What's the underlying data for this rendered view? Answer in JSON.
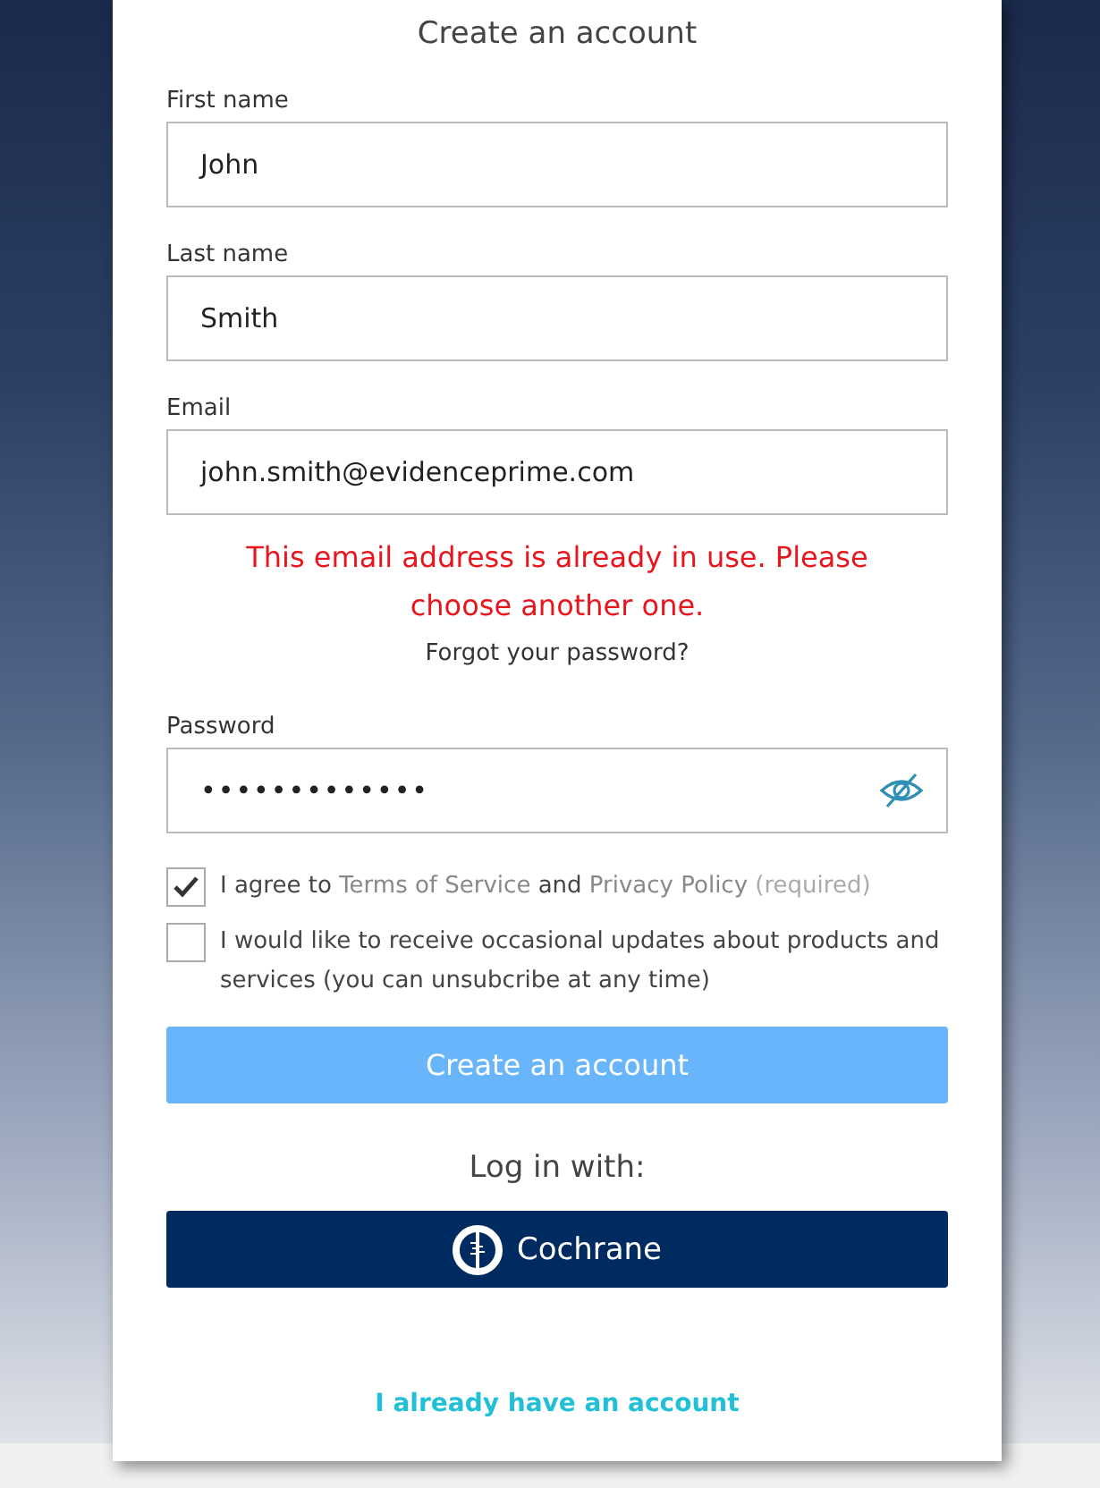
{
  "title": "Create an account",
  "fields": [
    {
      "label": "First name",
      "value": "John",
      "kind": "text"
    },
    {
      "label": "Last name",
      "value": "Smith",
      "kind": "text"
    },
    {
      "label": "Email",
      "value": "john.smith@evidenceprime.com",
      "kind": "text",
      "error": "This email address is already in use. Please choose another one.",
      "link": "Forgot your password?"
    },
    {
      "label": "Password",
      "value": "•••••••••••••",
      "kind": "password"
    }
  ],
  "checkboxes": [
    {
      "checked": true,
      "parts": [
        {
          "text": "I agree to ",
          "kind": "plain"
        },
        {
          "text": "Terms of Service",
          "kind": "link"
        },
        {
          "text": " and ",
          "kind": "plain"
        },
        {
          "text": "Privacy Policy",
          "kind": "link"
        },
        {
          "text": " (required)",
          "kind": "note"
        }
      ]
    },
    {
      "checked": false,
      "parts": [
        {
          "text": "I would like to receive occasional updates about products and services (you can unsubcribe at any time)",
          "kind": "plain"
        }
      ]
    }
  ],
  "submit": {
    "label": "Create an account",
    "disabled": true
  },
  "login_with": "Log in with:",
  "provider": {
    "label": "Cochrane"
  },
  "footer_link": "I already have an account"
}
